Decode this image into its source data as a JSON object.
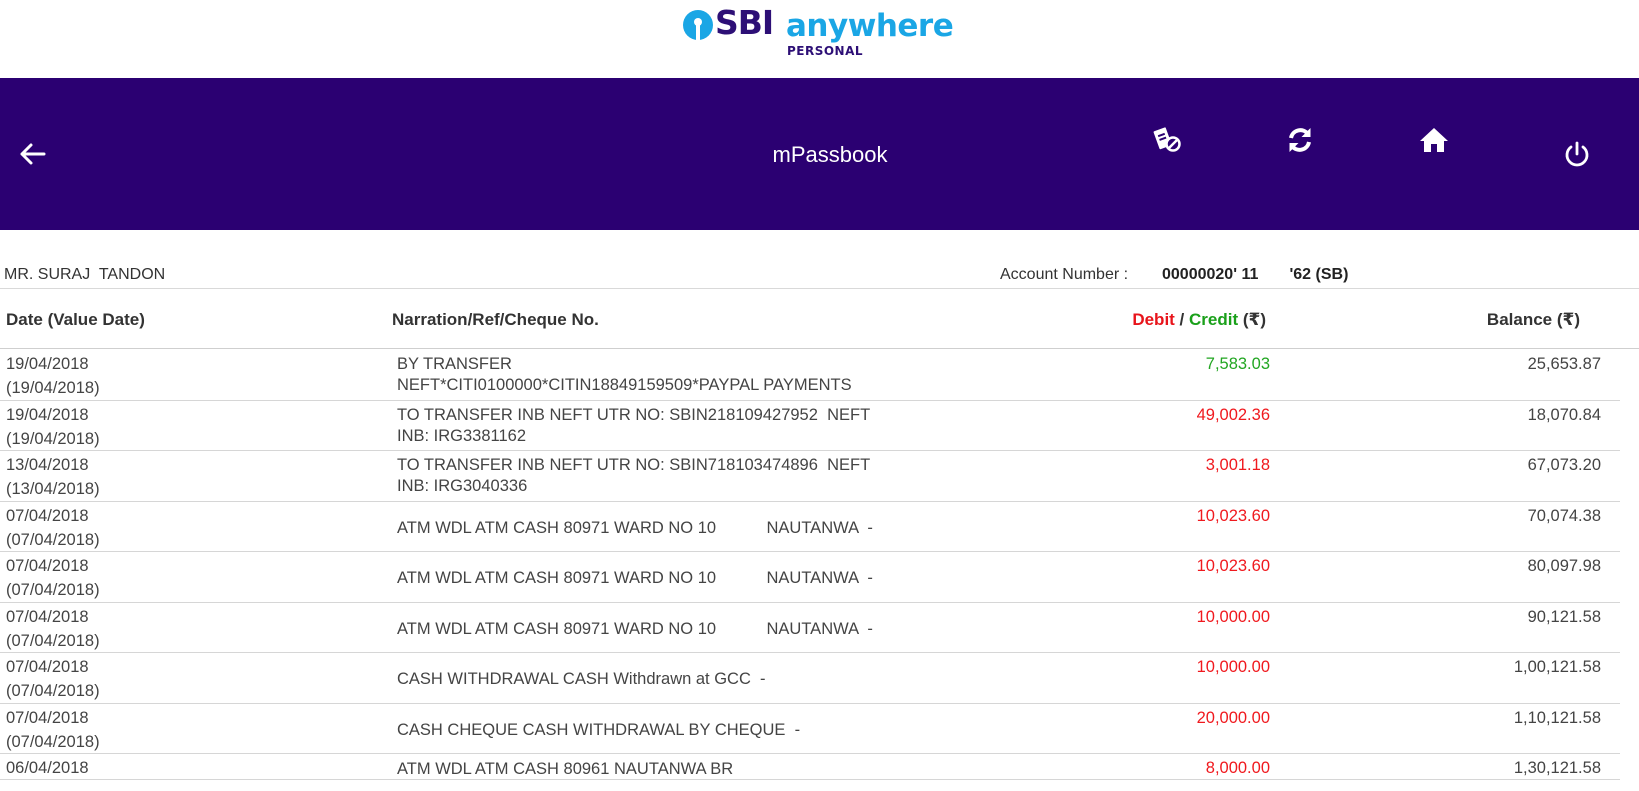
{
  "brand": {
    "name": "SBI",
    "product": "anywhere",
    "tagline": "PERSONAL",
    "logo_icon": "sbi-keyhole-logo",
    "colors": {
      "primary": "#2b0072",
      "accent": "#1aa6e5",
      "debit": "#f0191e",
      "credit": "#22a622"
    }
  },
  "header": {
    "title": "mPassbook",
    "icons": {
      "back": "arrow-left-icon",
      "no_cheque": "cheque-blocked-icon",
      "refresh": "refresh-icon",
      "home": "home-icon",
      "logout": "power-icon"
    }
  },
  "account": {
    "holder": "MR. SURAJ  TANDON",
    "number_label": "Account Number :",
    "number": "00000020' 11       '62 (SB)"
  },
  "columns": {
    "date": "Date (Value Date)",
    "narration": "Narration/Ref/Cheque No.",
    "debit": "Debit",
    "separator": " / ",
    "credit": "Credit",
    "amount_unit": " (₹)",
    "balance": "Balance (₹)"
  },
  "transactions": [
    {
      "date": "19/04/2018",
      "value_date": "(19/04/2018)",
      "narration": "BY TRANSFER\nNEFT*CITI0100000*CITIN18849159509*PAYPAL PAYMENTS",
      "amount": "7,583.03",
      "type": "credit",
      "balance": "25,653.87"
    },
    {
      "date": "19/04/2018",
      "value_date": "(19/04/2018)",
      "narration": "TO TRANSFER INB NEFT UTR NO: SBIN218109427952  NEFT\nINB: IRG3381162",
      "amount": "49,002.36",
      "type": "debit",
      "balance": "18,070.84"
    },
    {
      "date": "13/04/2018",
      "value_date": "(13/04/2018)",
      "narration": "TO TRANSFER INB NEFT UTR NO: SBIN718103474896  NEFT\nINB: IRG3040336",
      "amount": "3,001.18",
      "type": "debit",
      "balance": "67,073.20"
    },
    {
      "date": "07/04/2018",
      "value_date": "(07/04/2018)",
      "narration": "ATM WDL ATM CASH 80971 WARD NO 10           NAUTANWA  -",
      "amount": "10,023.60",
      "type": "debit",
      "balance": "70,074.38"
    },
    {
      "date": "07/04/2018",
      "value_date": "(07/04/2018)",
      "narration": "ATM WDL ATM CASH 80971 WARD NO 10           NAUTANWA  -",
      "amount": "10,023.60",
      "type": "debit",
      "balance": "80,097.98"
    },
    {
      "date": "07/04/2018",
      "value_date": "(07/04/2018)",
      "narration": "ATM WDL ATM CASH 80971 WARD NO 10           NAUTANWA  -",
      "amount": "10,000.00",
      "type": "debit",
      "balance": "90,121.58"
    },
    {
      "date": "07/04/2018",
      "value_date": "(07/04/2018)",
      "narration": "CASH WITHDRAWAL CASH Withdrawn at GCC  -",
      "amount": "10,000.00",
      "type": "debit",
      "balance": "1,00,121.58"
    },
    {
      "date": "07/04/2018",
      "value_date": "(07/04/2018)",
      "narration": "CASH CHEQUE CASH WITHDRAWAL BY CHEQUE  -",
      "amount": "20,000.00",
      "type": "debit",
      "balance": "1,10,121.58"
    },
    {
      "date": "06/04/2018",
      "value_date": "",
      "narration": "ATM WDL ATM CASH 80961 NAUTANWA BR",
      "amount": "8,000.00",
      "type": "debit",
      "balance": "1,30,121.58"
    }
  ]
}
